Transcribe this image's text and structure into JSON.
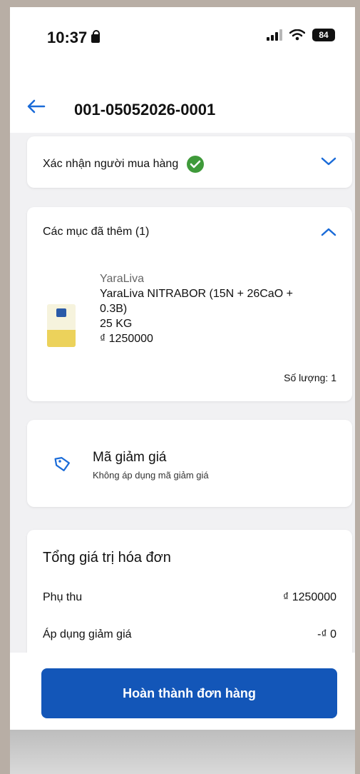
{
  "status": {
    "time": "10:37",
    "battery": "84"
  },
  "header": {
    "title": "001-05052026-0001"
  },
  "buyer_section": {
    "title": "Xác nhận người mua hàng"
  },
  "items_section": {
    "title": "Các mục đã thêm (1)",
    "items": [
      {
        "brand": "YaraLiva",
        "name_line1": "YaraLiva NITRABOR (15N + 26CaO +",
        "name_line2": "0.3B)",
        "size": "25 KG",
        "price": "₫ 1250000",
        "quantity": "Số lượng: 1"
      }
    ]
  },
  "coupon": {
    "title": "Mã giảm giá",
    "subtitle": "Không áp dụng mã giảm giá"
  },
  "total": {
    "title": "Tổng giá trị hóa đơn",
    "lines": [
      {
        "label": "Phụ thu",
        "value": "₫ 1250000"
      },
      {
        "label": "Áp dụng giảm giá",
        "value": "-₫  0"
      }
    ]
  },
  "cta": {
    "label": "Hoàn thành đơn hàng"
  },
  "colors": {
    "primary": "#1356b8",
    "success": "#3f9a3a",
    "link": "#1a6bd8"
  }
}
